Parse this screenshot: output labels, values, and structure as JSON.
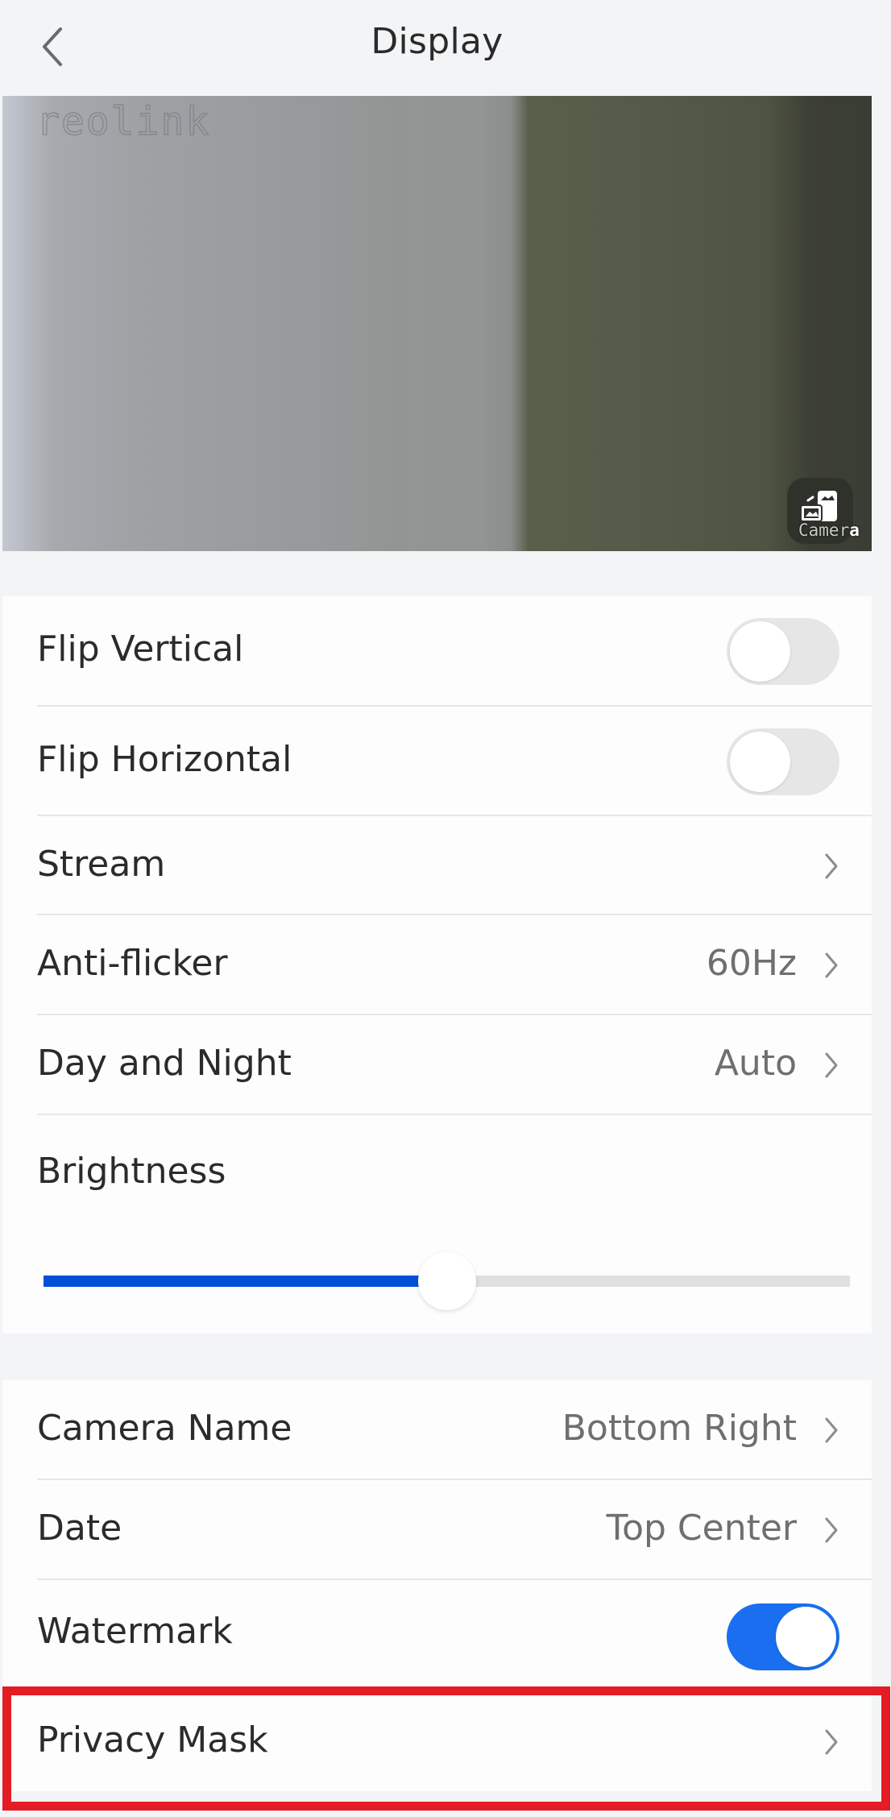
{
  "header": {
    "title": "Display",
    "back_icon": "chevron-left-icon"
  },
  "video": {
    "osd_logo": "reolink",
    "osd_camera_name_main": "Camer",
    "osd_camera_name_last": "a",
    "switch_icon": "camera-switch-icon"
  },
  "settings": {
    "flip_vertical": {
      "label": "Flip Vertical",
      "enabled": false
    },
    "flip_horizontal": {
      "label": "Flip Horizontal",
      "enabled": false
    },
    "stream": {
      "label": "Stream",
      "value": ""
    },
    "anti_flicker": {
      "label": "Anti-flicker",
      "value": "60Hz"
    },
    "day_night": {
      "label": "Day and Night",
      "value": "Auto"
    },
    "brightness": {
      "label": "Brightness",
      "value_fraction": 0.5
    }
  },
  "osd": {
    "camera_name": {
      "label": "Camera Name",
      "value": "Bottom Right"
    },
    "date": {
      "label": "Date",
      "value": "Top Center"
    },
    "watermark": {
      "label": "Watermark",
      "enabled": true
    },
    "privacy_mask": {
      "label": "Privacy Mask",
      "value": ""
    }
  },
  "colors": {
    "accent": "#1a6ef0",
    "slider_fill": "#0050d8",
    "highlight": "#e51c23"
  }
}
